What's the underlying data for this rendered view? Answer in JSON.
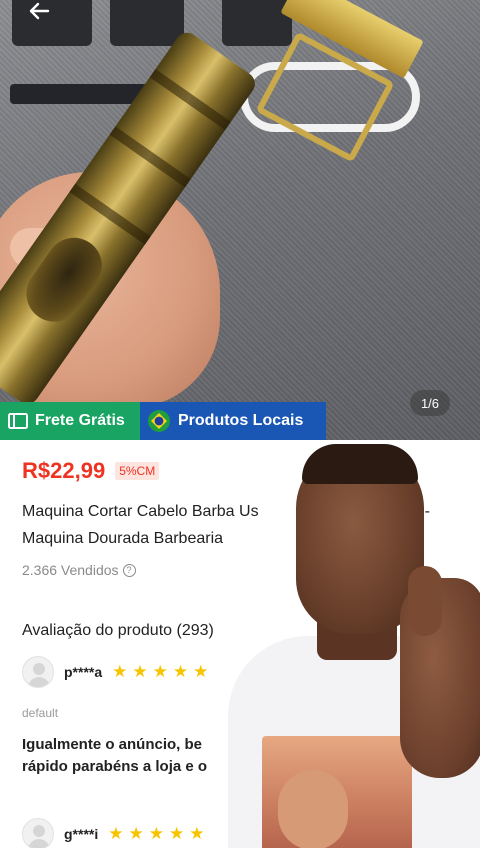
{
  "image_viewer": {
    "page_indicator": "1/6",
    "back_icon": "arrow-left-icon"
  },
  "badges": {
    "free_shipping": "Frete Grátis",
    "local_products": "Produtos Locais",
    "free_shipping_color": "#1aa463",
    "local_products_color": "#1a56b3"
  },
  "product": {
    "price": "R$22,99",
    "commission": "5%CM",
    "title_line1": "Maquina Cortar Cabelo Barba Us",
    "title_line1_tail": "l -",
    "title_line2": "Maquina Dourada Barbearia",
    "sold": "2.366 Vendidos",
    "price_color": "#ee3322"
  },
  "reviews": {
    "heading": "Avaliação do produto (293)",
    "items": [
      {
        "user": "p****a",
        "stars": 5,
        "variant": "default",
        "comment_line1": "Igualmente o anúncio, be",
        "comment_line2": "rápido parabéns a loja e o"
      },
      {
        "user": "g****i",
        "stars": 5
      }
    ],
    "star_color": "#f7c400"
  }
}
